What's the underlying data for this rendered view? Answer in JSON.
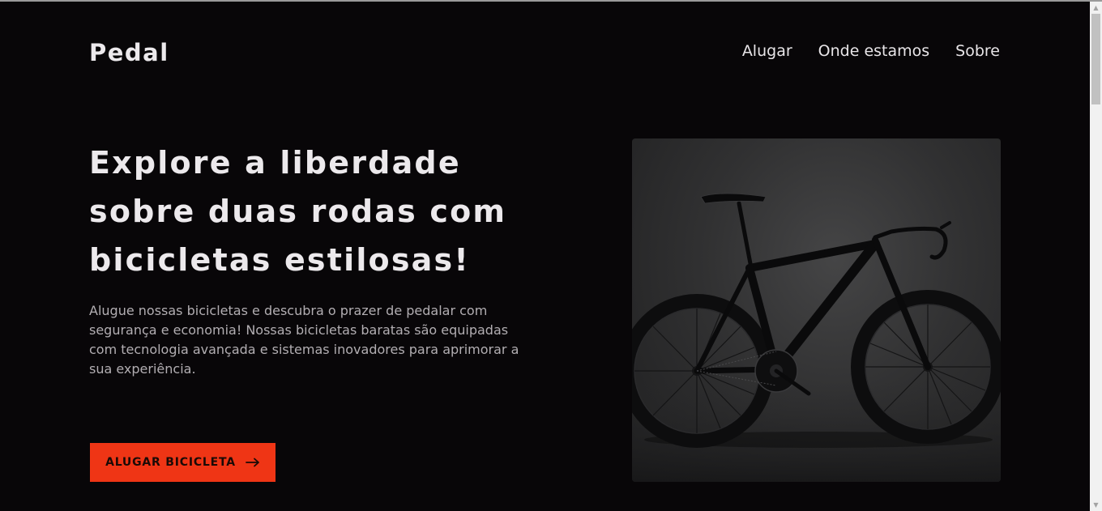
{
  "header": {
    "logo": "Pedal",
    "nav": [
      "Alugar",
      "Onde estamos",
      "Sobre"
    ]
  },
  "hero": {
    "title": "Explore a liberdade sobre duas rodas com bicicletas estilosas!",
    "description": "Alugue nossas bicicletas e descubra o prazer de pedalar com segurança e economia! Nossas bicicletas baratas são equipadas com tecnologia avançada e sistemas inovadores para aprimorar a sua experiência.",
    "cta_label": "ALUGAR BICICLETA",
    "cta_icon": "arrow-right-icon",
    "image": "black-road-bicycle"
  },
  "colors": {
    "background": "#080608",
    "text": "#ece9ec",
    "muted_text": "#b2aeb2",
    "accent": "#ef3515"
  },
  "scrollbar": {
    "up_icon": "scroll-up-arrow",
    "down_icon": "scroll-down-arrow"
  }
}
